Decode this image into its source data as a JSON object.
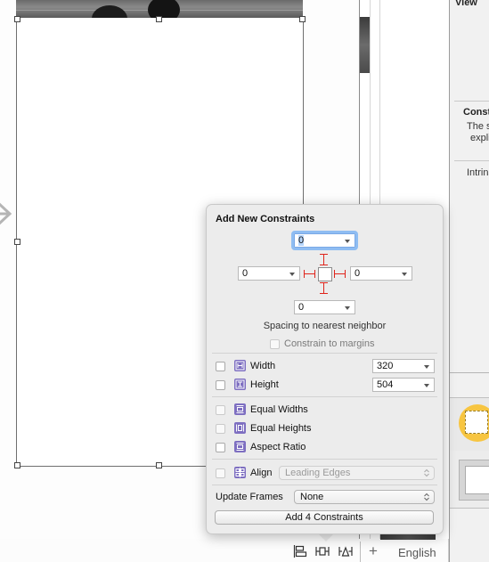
{
  "canvas": {
    "bottom_bar": {
      "icons": [
        "align-icon",
        "pin-icon",
        "resolve-issues-icon"
      ],
      "add_label": "+",
      "language": "English"
    }
  },
  "inspector": {
    "title": "View",
    "constraints_heading": "Const",
    "constraints_text_line1": "The s",
    "constraints_text_line2": "expli",
    "intrinsic_label": "Intrins"
  },
  "popover": {
    "title": "Add New Constraints",
    "spacing": {
      "top": "0",
      "left": "0",
      "right": "0",
      "bottom": "0"
    },
    "spacing_caption": "Spacing to nearest neighbor",
    "constrain_to_margins": {
      "label": "Constrain to margins",
      "checked": false
    },
    "size_rows": [
      {
        "label": "Width",
        "value": "320",
        "checked": false,
        "icon": "width-constraint-icon"
      },
      {
        "label": "Height",
        "value": "504",
        "checked": false,
        "icon": "height-constraint-icon"
      }
    ],
    "equal_rows": [
      {
        "label": "Equal Widths",
        "checked": false,
        "enabled": false,
        "icon": "equal-widths-icon"
      },
      {
        "label": "Equal Heights",
        "checked": false,
        "enabled": false,
        "icon": "equal-heights-icon"
      },
      {
        "label": "Aspect Ratio",
        "checked": false,
        "enabled": true,
        "icon": "aspect-ratio-icon"
      }
    ],
    "align": {
      "label": "Align",
      "value": "Leading Edges",
      "checked": false,
      "enabled": false
    },
    "update_frames": {
      "label": "Update Frames",
      "value": "None"
    },
    "add_button": "Add 4 Constraints"
  }
}
